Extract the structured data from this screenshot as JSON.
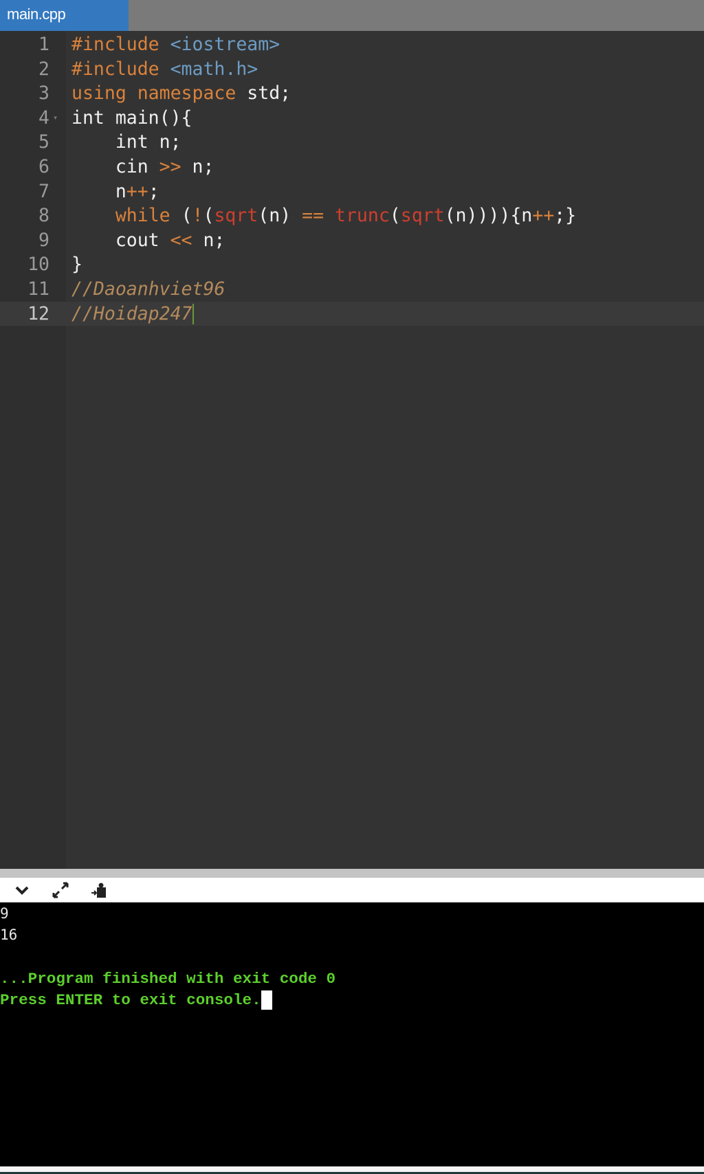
{
  "tab": {
    "label": "main.cpp"
  },
  "editor": {
    "active_line": 12,
    "lines": [
      {
        "n": "1",
        "tokens": [
          [
            "#include ",
            "kw"
          ],
          [
            "<iostream>",
            "str"
          ]
        ]
      },
      {
        "n": "2",
        "tokens": [
          [
            "#include ",
            "kw"
          ],
          [
            "<math.h>",
            "str"
          ]
        ]
      },
      {
        "n": "3",
        "tokens": [
          [
            "using namespace",
            "kw"
          ],
          [
            " std;",
            ""
          ]
        ]
      },
      {
        "n": "4",
        "fold": true,
        "tokens": [
          [
            "int main(){",
            ""
          ]
        ]
      },
      {
        "n": "5",
        "tokens": [
          [
            "    int n;",
            ""
          ]
        ]
      },
      {
        "n": "6",
        "tokens": [
          [
            "    cin ",
            ""
          ],
          [
            ">>",
            "op"
          ],
          [
            " n;",
            ""
          ]
        ]
      },
      {
        "n": "7",
        "tokens": [
          [
            "    n",
            ""
          ],
          [
            "++",
            "op"
          ],
          [
            ";",
            ""
          ]
        ]
      },
      {
        "n": "8",
        "tokens": [
          [
            "    ",
            ""
          ],
          [
            "while",
            "kw"
          ],
          [
            " (",
            ""
          ],
          [
            "!",
            "op"
          ],
          [
            "(",
            ""
          ],
          [
            "sqrt",
            "fn"
          ],
          [
            "(n) ",
            ""
          ],
          [
            "==",
            "op"
          ],
          [
            " ",
            ""
          ],
          [
            "trunc",
            "fn"
          ],
          [
            "(",
            ""
          ],
          [
            "sqrt",
            "fn"
          ],
          [
            "(n)))){n",
            ""
          ],
          [
            "++",
            "op"
          ],
          [
            ";}",
            ""
          ]
        ]
      },
      {
        "n": "9",
        "tokens": [
          [
            "    cout ",
            ""
          ],
          [
            "<<",
            "op"
          ],
          [
            " n;",
            ""
          ]
        ]
      },
      {
        "n": "10",
        "tokens": [
          [
            "}",
            ""
          ]
        ]
      },
      {
        "n": "11",
        "tokens": [
          [
            "//Daoanhviet96",
            "cm"
          ]
        ]
      },
      {
        "n": "12",
        "tokens": [
          [
            "//Hoidap247",
            "cm"
          ]
        ]
      }
    ]
  },
  "toolbar": {
    "icons": [
      "chevron-down-icon",
      "expand-icon",
      "stop-icon"
    ]
  },
  "console": {
    "output": [
      "9",
      "16"
    ],
    "status": "...Program finished with exit code 0",
    "prompt": "Press ENTER to exit console.",
    "colors": {
      "status": "#5ccf2c",
      "output": "#e6e6e6"
    }
  }
}
